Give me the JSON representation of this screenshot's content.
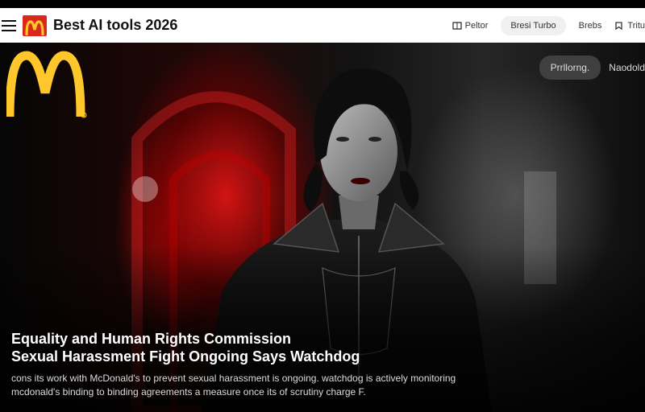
{
  "header": {
    "site_title": "Best AI tools 2026",
    "nav": [
      {
        "label": "Peltor",
        "icon": "book-icon"
      },
      {
        "label": "Bresi Turbo",
        "icon": ""
      },
      {
        "label": "Brebs",
        "icon": ""
      },
      {
        "label": "Tritu",
        "icon": "bookmark-icon"
      }
    ]
  },
  "hero": {
    "buttons": [
      "Prrllorng.",
      "Naodold"
    ],
    "headline_line1": "Equality and Human Rights Commission",
    "headline_line2": "Sexual Harassment Fight Ongoing Says Watchdog",
    "excerpt": "cons its work with McDonald's to prevent sexual harassment is ongoing. watchdog is actively monitoring mcdonald's binding to binding agreements a measure once its of scrutiny charge F.",
    "colors": {
      "brand_red": "#da291c",
      "brand_yellow": "#ffc72c",
      "accent_red": "#c41010"
    }
  }
}
